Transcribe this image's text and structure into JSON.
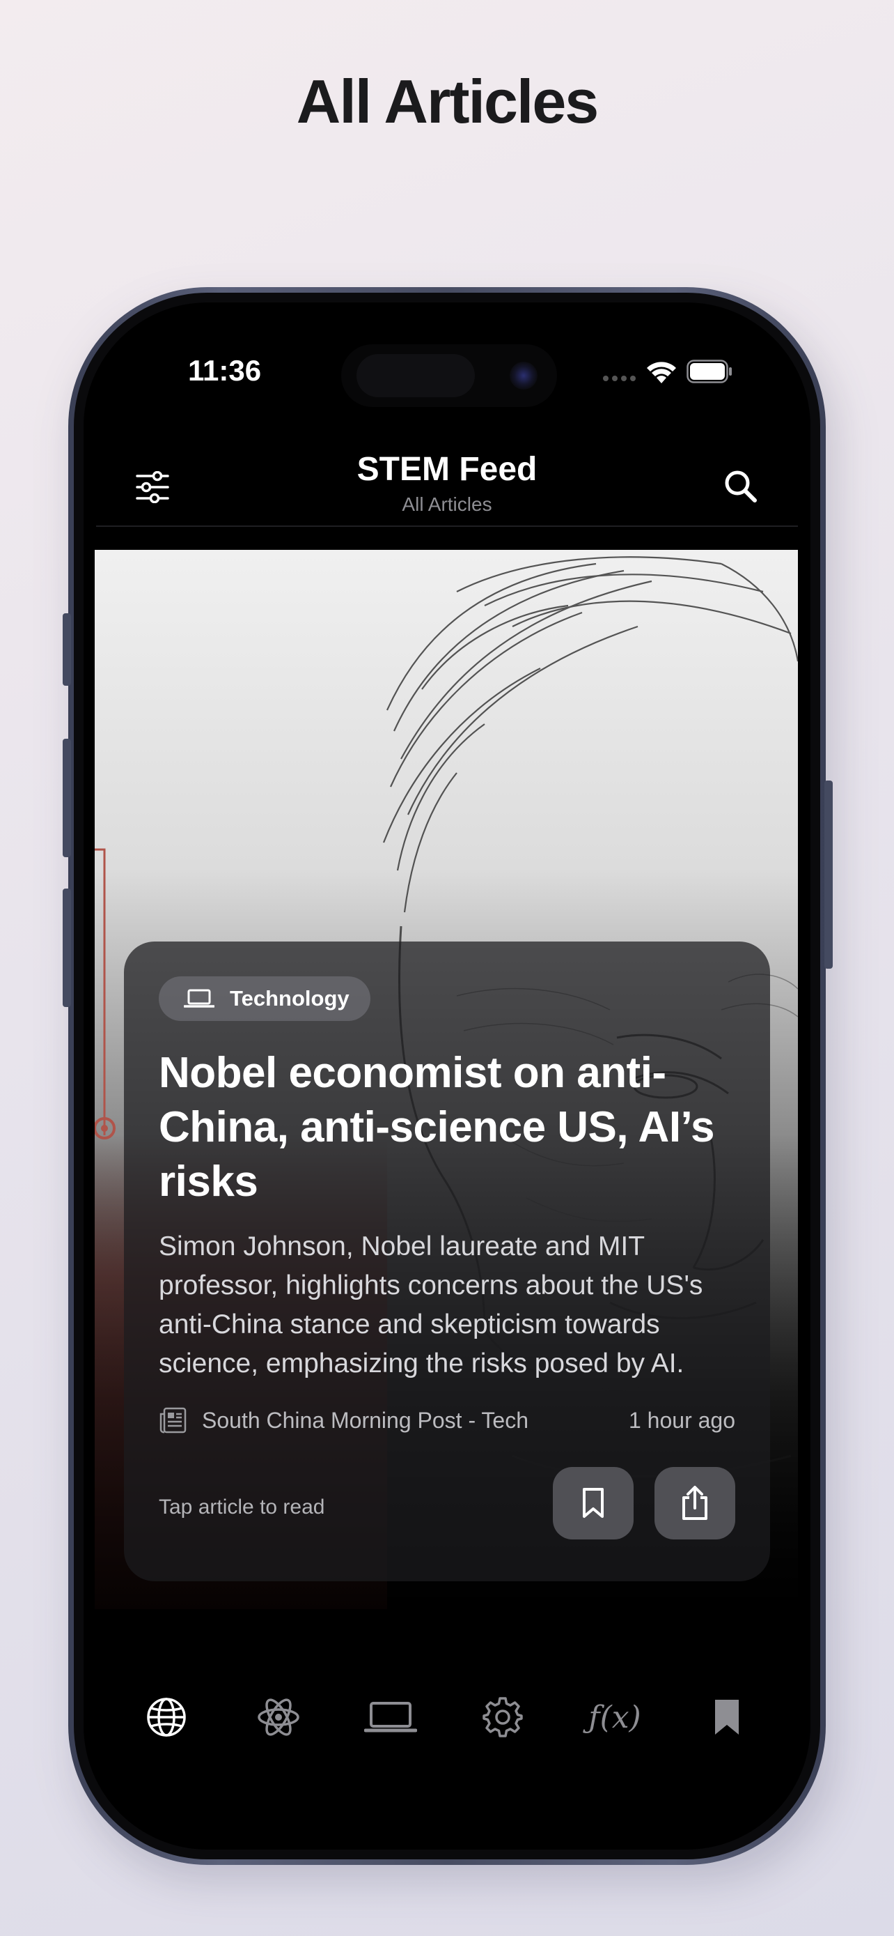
{
  "page_heading": "All Articles",
  "status_bar": {
    "time": "11:36"
  },
  "nav": {
    "title": "STEM Feed",
    "subtitle": "All Articles",
    "left_icon": "filter-sliders-icon",
    "right_icon": "search-icon"
  },
  "article": {
    "category": "Technology",
    "category_icon": "laptop-icon",
    "headline": "Nobel economist on anti-China, anti-science US, AI’s risks",
    "summary": "Simon Johnson, Nobel laureate and MIT professor, highlights concerns about the US's anti-China stance and skepticism towards science, emphasizing the risks posed by AI.",
    "source": "South China Morning Post - Tech",
    "source_icon": "newspaper-icon",
    "time_ago": "1 hour ago",
    "tap_hint": "Tap article to read",
    "actions": [
      "bookmark-icon",
      "share-icon"
    ]
  },
  "tab_bar": {
    "tabs": [
      {
        "icon": "globe-icon",
        "active": true
      },
      {
        "icon": "atom-icon",
        "active": false
      },
      {
        "icon": "laptop-icon",
        "active": false
      },
      {
        "icon": "gear-icon",
        "active": false
      },
      {
        "icon": "function-icon",
        "label": "ƒ(x)",
        "active": false
      },
      {
        "icon": "bookmark-filled-icon",
        "active": false
      }
    ]
  },
  "colors": {
    "accent": "#ffffff",
    "tab_inactive": "#8e8e93",
    "background": "#000000"
  }
}
